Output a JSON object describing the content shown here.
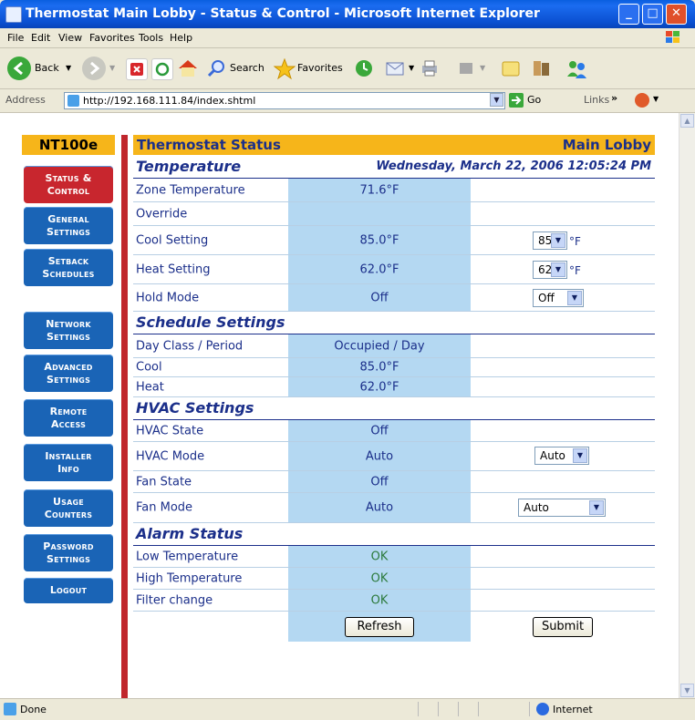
{
  "window": {
    "title": "Thermostat Main Lobby - Status & Control - Microsoft Internet Explorer"
  },
  "menu": [
    "File",
    "Edit",
    "View",
    "Favorites",
    "Tools",
    "Help"
  ],
  "toolbar": {
    "back": "Back",
    "search": "Search",
    "favorites": "Favorites"
  },
  "address": {
    "label": "Address",
    "url": "http://192.168.111.84/index.shtml",
    "go": "Go",
    "links": "Links"
  },
  "status_bar": {
    "left": "Done",
    "zone": "Internet"
  },
  "nav": {
    "brand": "NT100e",
    "items": [
      {
        "line1": "Status &",
        "line2": "Control"
      },
      {
        "line1": "General",
        "line2": "Settings"
      },
      {
        "line1": "Setback",
        "line2": "Schedules"
      },
      {
        "line1": "Network",
        "line2": "Settings"
      },
      {
        "line1": "Advanced",
        "line2": "Settings"
      },
      {
        "line1": "Remote",
        "line2": "Access"
      },
      {
        "line1": "Installer",
        "line2": "Info"
      },
      {
        "line1": "Usage",
        "line2": "Counters"
      },
      {
        "line1": "Password",
        "line2": "Settings"
      },
      {
        "line1": "Logout",
        "line2": ""
      }
    ]
  },
  "header": {
    "title": "Thermostat Status",
    "location": "Main Lobby"
  },
  "temperature": {
    "title": "Temperature",
    "datetime": "Wednesday, March 22, 2006 12:05:24 PM",
    "zone_label": "Zone Temperature",
    "zone_value": "71.6°F",
    "override_label": "Override",
    "override_value": "",
    "cool_label": "Cool Setting",
    "cool_value": "85.0°F",
    "cool_select": "85",
    "cool_unit": "°F",
    "heat_label": "Heat Setting",
    "heat_value": "62.0°F",
    "heat_select": "62",
    "heat_unit": "°F",
    "hold_label": "Hold Mode",
    "hold_value": "Off",
    "hold_select": "Off"
  },
  "schedule": {
    "title": "Schedule Settings",
    "dayclass_label": "Day Class / Period",
    "dayclass_value": "Occupied / Day",
    "cool_label": "Cool",
    "cool_value": "85.0°F",
    "heat_label": "Heat",
    "heat_value": "62.0°F"
  },
  "hvac": {
    "title": "HVAC Settings",
    "state_label": "HVAC State",
    "state_value": "Off",
    "mode_label": "HVAC Mode",
    "mode_value": "Auto",
    "mode_select": "Auto",
    "fanstate_label": "Fan State",
    "fanstate_value": "Off",
    "fanmode_label": "Fan Mode",
    "fanmode_value": "Auto",
    "fanmode_select": "Auto"
  },
  "alarm": {
    "title": "Alarm Status",
    "low_label": "Low Temperature",
    "low_value": "OK",
    "high_label": "High Temperature",
    "high_value": "OK",
    "filter_label": "Filter change",
    "filter_value": "OK"
  },
  "buttons": {
    "refresh": "Refresh",
    "submit": "Submit"
  },
  "colors": {
    "nav_blue": "#1a64b6",
    "nav_active": "#c8262e",
    "header_gold": "#f6b51a",
    "value_blue": "#b4d8f2",
    "text_navy": "#1b2f8a"
  }
}
